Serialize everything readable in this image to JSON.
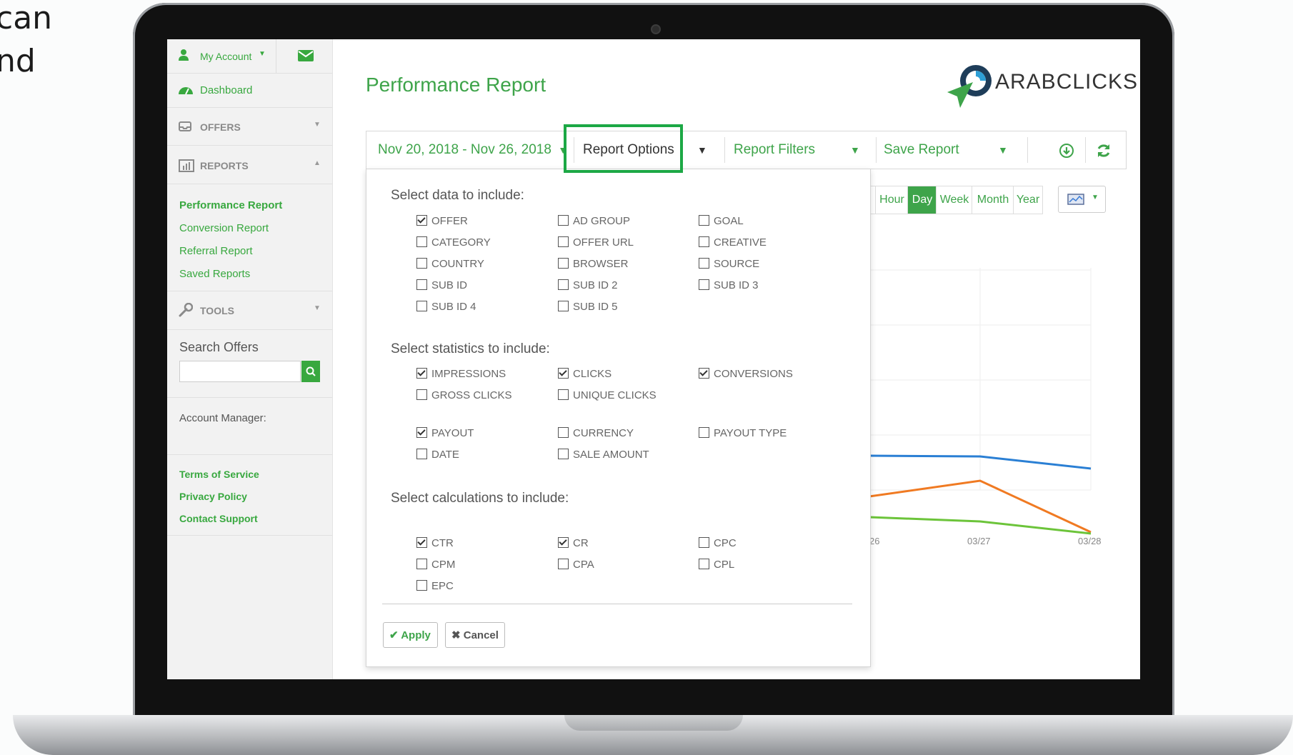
{
  "background": {
    "line1": "can",
    "line2": "nd"
  },
  "sidebar": {
    "account": "My Account",
    "dashboard": "Dashboard",
    "offers": "OFFERS",
    "reports": "REPORTS",
    "report_links": [
      "Performance Report",
      "Conversion Report",
      "Referral Report",
      "Saved Reports"
    ],
    "tools": "TOOLS",
    "search_label": "Search Offers",
    "search_value": "",
    "account_manager": "Account Manager:",
    "footer_links": [
      "Terms of Service",
      "Privacy Policy",
      "Contact Support"
    ]
  },
  "header": {
    "title": "Performance Report",
    "logo": "ARABCLICKS"
  },
  "toolbar": {
    "date_range": "Nov 20, 2018 - Nov 26, 2018",
    "report_options": "Report Options",
    "report_filters": "Report Filters",
    "save_report": "Save Report"
  },
  "periods": [
    "Hour",
    "Day",
    "Week",
    "Month",
    "Year"
  ],
  "active_period": "Day",
  "options": {
    "data_heading": "Select data to include:",
    "data": [
      {
        "label": "OFFER",
        "checked": true
      },
      {
        "label": "AD GROUP",
        "checked": false
      },
      {
        "label": "GOAL",
        "checked": false
      },
      {
        "label": "CATEGORY",
        "checked": false
      },
      {
        "label": "OFFER URL",
        "checked": false
      },
      {
        "label": "CREATIVE",
        "checked": false
      },
      {
        "label": "COUNTRY",
        "checked": false
      },
      {
        "label": "BROWSER",
        "checked": false
      },
      {
        "label": "SOURCE",
        "checked": false
      },
      {
        "label": "SUB ID",
        "checked": false
      },
      {
        "label": "SUB ID 2",
        "checked": false
      },
      {
        "label": "SUB ID 3",
        "checked": false
      },
      {
        "label": "SUB ID 4",
        "checked": false
      },
      {
        "label": "SUB ID 5",
        "checked": false
      }
    ],
    "stats_heading": "Select statistics to include:",
    "stats_a": [
      {
        "label": "IMPRESSIONS",
        "checked": true
      },
      {
        "label": "CLICKS",
        "checked": true
      },
      {
        "label": "CONVERSIONS",
        "checked": true
      },
      {
        "label": "GROSS CLICKS",
        "checked": false
      },
      {
        "label": "UNIQUE CLICKS",
        "checked": false
      }
    ],
    "stats_b": [
      {
        "label": "PAYOUT",
        "checked": true
      },
      {
        "label": "CURRENCY",
        "checked": false
      },
      {
        "label": "PAYOUT TYPE",
        "checked": false
      },
      {
        "label": "DATE",
        "checked": false
      },
      {
        "label": "SALE AMOUNT",
        "checked": false
      }
    ],
    "calc_heading": "Select calculations to include:",
    "calcs": [
      {
        "label": "CTR",
        "checked": true
      },
      {
        "label": "CR",
        "checked": true
      },
      {
        "label": "CPC",
        "checked": false
      },
      {
        "label": "CPM",
        "checked": false
      },
      {
        "label": "CPA",
        "checked": false
      },
      {
        "label": "CPL",
        "checked": false
      },
      {
        "label": "EPC",
        "checked": false
      }
    ],
    "apply": "Apply",
    "cancel": "Cancel"
  },
  "chart": {
    "x_labels": [
      "26",
      "03/27",
      "03/28"
    ],
    "colors": {
      "blue": "#2a7fd4",
      "orange": "#f07a22",
      "green": "#6cc43a"
    }
  },
  "colors": {
    "accent": "#3ea44a",
    "highlight": "#1ca845"
  }
}
